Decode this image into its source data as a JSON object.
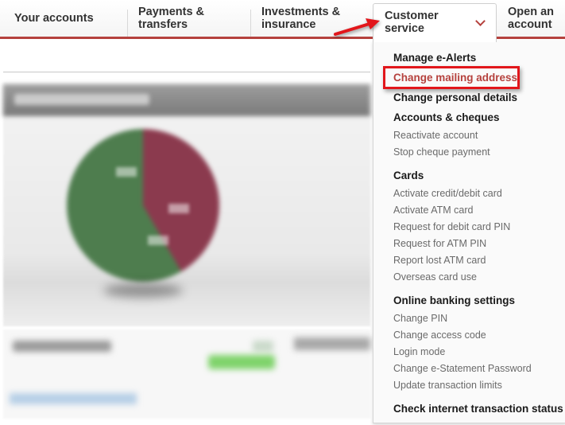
{
  "navbar": {
    "items": [
      {
        "label_line1": "Your accounts",
        "label_line2": ""
      },
      {
        "label_line1": "Payments &",
        "label_line2": "transfers"
      },
      {
        "label_line1": "Investments &",
        "label_line2": "insurance"
      },
      {
        "label_line1": "Customer",
        "label_line2": "service",
        "active": true,
        "icon": "chevron-down-icon"
      },
      {
        "label_line1": "Open an",
        "label_line2": "account"
      }
    ],
    "accent_color": "#b5413d"
  },
  "dropdown": {
    "sections": [
      {
        "heading": "Manage e-Alerts"
      },
      {
        "heading": "Change mailing address",
        "highlighted": true
      },
      {
        "heading": "Change personal details"
      },
      {
        "heading": "Accounts & cheques",
        "items": [
          "Reactivate account",
          "Stop cheque payment"
        ]
      },
      {
        "heading": "Cards",
        "items": [
          "Activate credit/debit card",
          "Activate ATM card",
          "Request for debit card PIN",
          "Request for ATM PIN",
          "Report lost ATM card",
          "Overseas card use"
        ]
      },
      {
        "heading": "Online banking settings",
        "items": [
          "Change PIN",
          "Change access code",
          "Login mode",
          "Change e-Statement Password",
          "Update transaction limits"
        ]
      },
      {
        "heading": "Check internet transaction status"
      }
    ]
  },
  "annotations": {
    "highlight_color": "#e2161b",
    "arrow_target": "Customer service"
  },
  "background": {
    "blurred": true
  }
}
